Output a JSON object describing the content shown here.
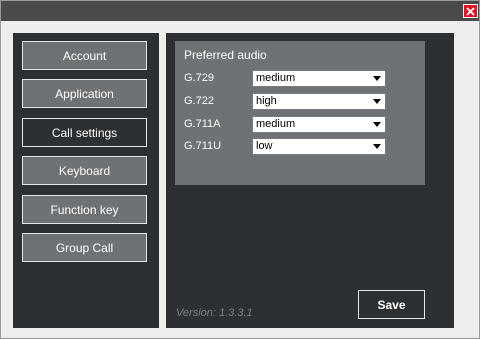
{
  "window": {
    "close_icon": "close-icon"
  },
  "sidebar": {
    "items": [
      {
        "id": "account",
        "label": "Account"
      },
      {
        "id": "application",
        "label": "Application"
      },
      {
        "id": "call-settings",
        "label": "Call settings",
        "active": true
      },
      {
        "id": "keyboard",
        "label": "Keyboard"
      },
      {
        "id": "function-key",
        "label": "Function key"
      },
      {
        "id": "group-call",
        "label": "Group Call"
      }
    ]
  },
  "audio": {
    "title": "Preferred audio",
    "codecs": [
      {
        "label": "G.729",
        "value": "medium"
      },
      {
        "label": "G.722",
        "value": "high"
      },
      {
        "label": "G.711A",
        "value": "medium"
      },
      {
        "label": "G.711U",
        "value": "low"
      }
    ]
  },
  "footer": {
    "version": "Version: 1.3.3.1",
    "save_label": "Save"
  },
  "colors": {
    "background": "#2c3033",
    "panel": "#6e7275",
    "close": "#e81123"
  }
}
